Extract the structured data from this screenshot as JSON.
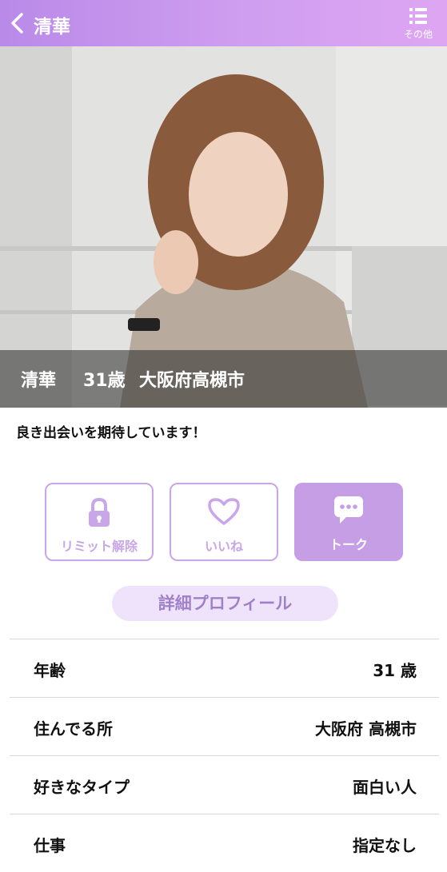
{
  "header": {
    "title": "清華",
    "more_label": "その他"
  },
  "profile": {
    "name": "清華",
    "age": "31歳",
    "location": "大阪府高槻市",
    "message": "良き出会いを期待しています！"
  },
  "actions": [
    {
      "label": "リミット解除",
      "icon": "lock-icon"
    },
    {
      "label": "いいね",
      "icon": "heart-icon"
    },
    {
      "label": "トーク",
      "icon": "chat-bubble-icon"
    }
  ],
  "detail_button": "詳細プロフィール",
  "details": [
    {
      "key": "年齢",
      "value": "31 歳"
    },
    {
      "key": "住んでる所",
      "value": "大阪府 高槻市"
    },
    {
      "key": "好きなタイプ",
      "value": "面白い人"
    },
    {
      "key": "仕事",
      "value": "指定なし"
    }
  ],
  "colors": {
    "accent": "#c59ee6",
    "header_start": "#b98ae8",
    "header_end": "#dea6f2"
  }
}
